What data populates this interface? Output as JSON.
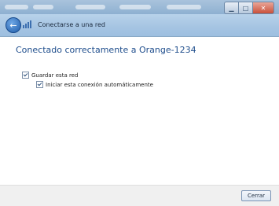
{
  "window": {
    "title": "Conectarse a una red",
    "caption": {
      "minimize_icon": "minimize-icon",
      "maximize_icon": "maximize-icon",
      "close_icon": "close-icon"
    }
  },
  "main": {
    "headline": "Conectado correctamente a Orange-1234",
    "options": [
      {
        "label": "Guardar esta red",
        "checked": true
      },
      {
        "label": "Iniciar esta conexión automáticamente",
        "checked": true
      }
    ]
  },
  "footer": {
    "close_label": "Cerrar"
  },
  "colors": {
    "headline": "#1e4d8c",
    "titlebar": "#a5c4e2",
    "footer_bg": "#f0f0f0"
  }
}
